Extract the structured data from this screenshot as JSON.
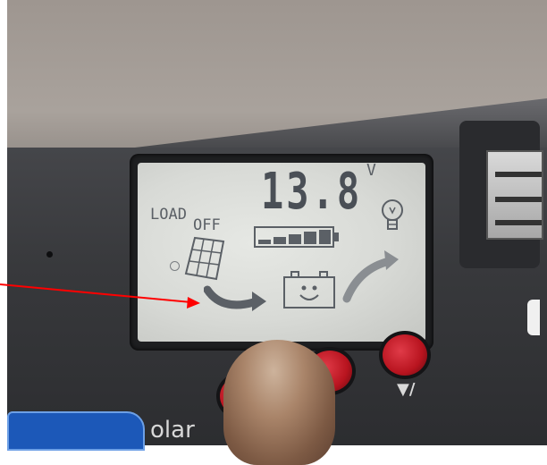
{
  "lcd": {
    "voltage": "13.8",
    "unit": "V",
    "load_label": "LOAD",
    "load_state": "OFF",
    "battery_level_bars": 5,
    "battery_level_fraction": 0.8,
    "icons": [
      "solar-panel-icon",
      "charge-flow-arrow-icon",
      "battery-icon",
      "load-flow-arrow-icon",
      "light-bulb-icon",
      "battery-level-icon"
    ]
  },
  "controls": {
    "right_button_caption": "▼/",
    "buttons": [
      "left-button",
      "middle-button",
      "right-button"
    ]
  },
  "branding": {
    "partial_text": "olar"
  },
  "colors": {
    "lcd_background": "#d8dad6",
    "lcd_segments": "#4e5358",
    "button_red": "#c41a25",
    "annotation_arrow": "#ff0000",
    "brand_blue": "#1c58b8"
  }
}
